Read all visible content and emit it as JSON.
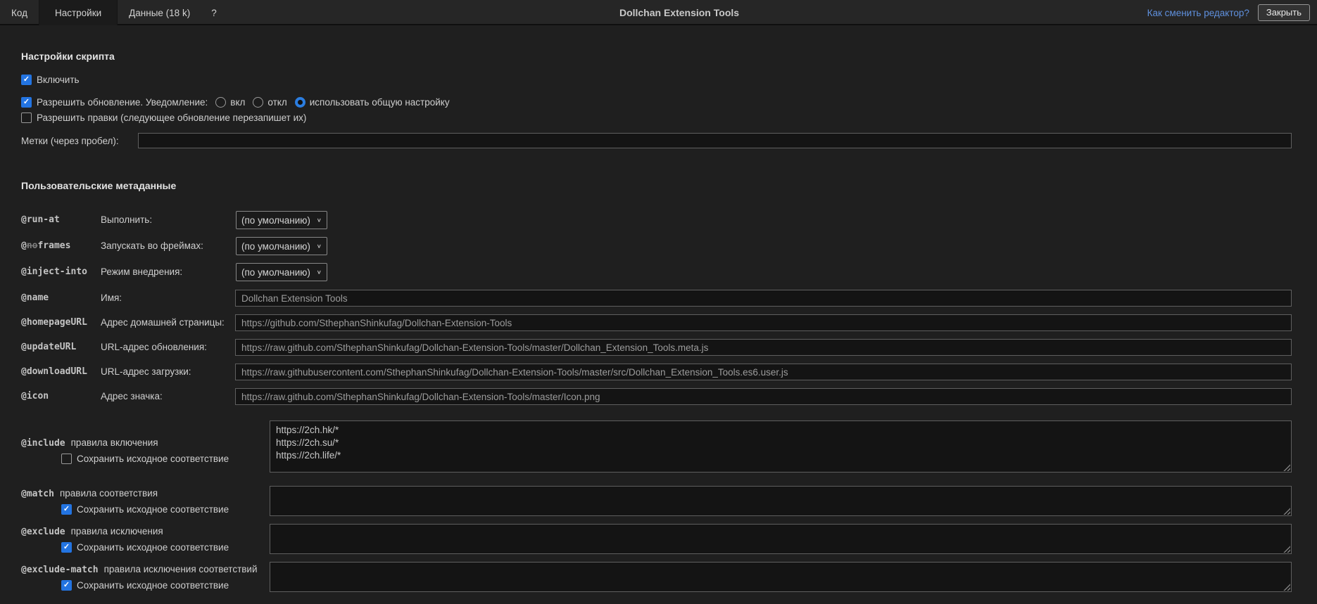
{
  "icons": {
    "check": "✓",
    "chevron": "∨"
  },
  "colors": {
    "page_bg": "#1f1f1f",
    "bar_bg": "#262626",
    "active_tab_bg": "#1b1b1b",
    "accent_blue": "#2374e1",
    "radio_blue": "#2b7de0",
    "link_blue": "#5f90dd",
    "input_bg": "#141414",
    "input_border": "#5f5f5f",
    "input_text": "#9c9c9c",
    "textarea_text": "#c8c8c8"
  },
  "header": {
    "tabs": [
      {
        "label": "Код"
      },
      {
        "label": "Настройки"
      },
      {
        "label": "Данные (18 k)"
      },
      {
        "label": "?"
      }
    ],
    "active_tab": "Настройки",
    "title": "Dollchan Extension Tools",
    "change_editor_link": "Как сменить редактор?",
    "close_button": "Закрыть"
  },
  "script_settings": {
    "heading": "Настройки скрипта",
    "enable": {
      "label": "Включить",
      "checked": true
    },
    "update": {
      "label": "Разрешить обновление. Уведомление:",
      "checked": true,
      "options": [
        {
          "label": "вкл",
          "selected": false
        },
        {
          "label": "откл",
          "selected": false
        },
        {
          "label": "использовать общую настройку",
          "selected": true
        }
      ]
    },
    "edits": {
      "label": "Разрешить правки (следующее обновление перезапишет их)",
      "checked": false
    },
    "tags": {
      "label": "Метки (через пробел):",
      "value": ""
    }
  },
  "metadata": {
    "heading": "Пользовательские метаданные",
    "run_at": {
      "tag": "@run-at",
      "label": "Выполнить:",
      "value": "(по умолчанию)"
    },
    "noframes": {
      "tag_at": "@",
      "tag_struck": "no",
      "tag_rest": "frames",
      "label": "Запускать во фреймах:",
      "value": "(по умолчанию)"
    },
    "inject_into": {
      "tag": "@inject-into",
      "label": "Режим внедрения:",
      "value": "(по умолчанию)"
    },
    "name": {
      "tag": "@name",
      "label": "Имя:",
      "value": "Dollchan Extension Tools"
    },
    "homepage": {
      "tag": "@homepageURL",
      "label": "Адрес домашней страницы:",
      "value": "https://github.com/SthephanShinkufag/Dollchan-Extension-Tools"
    },
    "update_url": {
      "tag": "@updateURL",
      "label": "URL-адрес обновления:",
      "value": "https://raw.github.com/SthephanShinkufag/Dollchan-Extension-Tools/master/Dollchan_Extension_Tools.meta.js"
    },
    "download_url": {
      "tag": "@downloadURL",
      "label": "URL-адрес загрузки:",
      "value": "https://raw.githubusercontent.com/SthephanShinkufag/Dollchan-Extension-Tools/master/src/Dollchan_Extension_Tools.es6.user.js"
    },
    "icon": {
      "tag": "@icon",
      "label": "Адрес значка:",
      "value": "https://raw.github.com/SthephanShinkufag/Dollchan-Extension-Tools/master/Icon.png"
    },
    "include": {
      "tag": "@include",
      "label": "правила включения",
      "keep_label": "Сохранить исходное соответствие",
      "keep_checked": false,
      "value": "https://2ch.hk/*\nhttps://2ch.su/*\nhttps://2ch.life/*"
    },
    "match": {
      "tag": "@match",
      "label": "правила соответствия",
      "keep_label": "Сохранить исходное соответствие",
      "keep_checked": true,
      "value": ""
    },
    "exclude": {
      "tag": "@exclude",
      "label": "правила исключения",
      "keep_label": "Сохранить исходное соответствие",
      "keep_checked": true,
      "value": ""
    },
    "exclude_match": {
      "tag": "@exclude-match",
      "label": "правила исключения соответствий",
      "keep_label": "Сохранить исходное соответствие",
      "keep_checked": true,
      "value": ""
    }
  }
}
